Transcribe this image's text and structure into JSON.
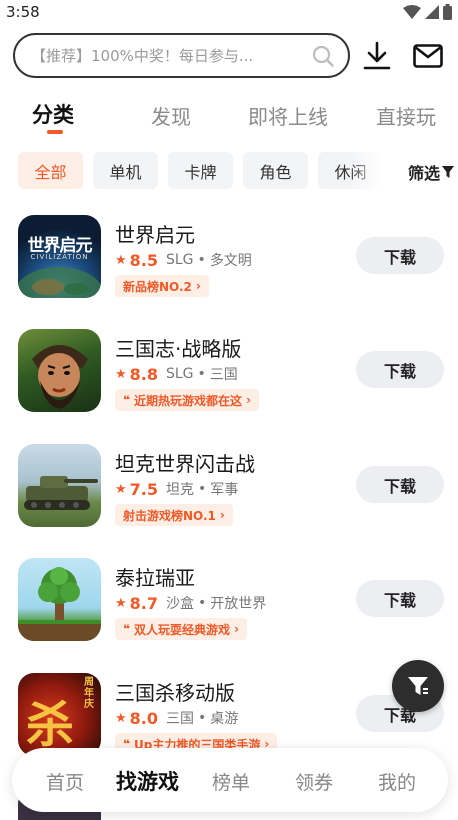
{
  "status_bar": {
    "time": "3:58"
  },
  "search": {
    "placeholder": "【推荐】100%中奖！每日参与..."
  },
  "tabs": [
    {
      "label": "分类",
      "active": true
    },
    {
      "label": "发现",
      "active": false
    },
    {
      "label": "即将上线",
      "active": false
    },
    {
      "label": "直接玩",
      "active": false
    }
  ],
  "chips": [
    {
      "label": "全部",
      "active": true
    },
    {
      "label": "单机",
      "active": false
    },
    {
      "label": "卡牌",
      "active": false
    },
    {
      "label": "角色",
      "active": false
    },
    {
      "label": "休闲",
      "active": false
    }
  ],
  "filter": {
    "label": "筛选"
  },
  "games": [
    {
      "name": "世界启元",
      "score": "8.5",
      "genre": "SLG",
      "theme": "多文明",
      "tag": "新品榜NO.2",
      "download": "下载",
      "icon_text": "世界启元",
      "icon_subtext": "CIVILIZATION"
    },
    {
      "name": "三国志·战略版",
      "score": "8.8",
      "genre": "SLG",
      "theme": "三国",
      "tag": "近期热玩游戏都在这",
      "download": "下载"
    },
    {
      "name": "坦克世界闪击战",
      "score": "7.5",
      "genre": "坦克",
      "theme": "军事",
      "tag": "射击游戏榜NO.1",
      "download": "下载"
    },
    {
      "name": "泰拉瑞亚",
      "score": "8.7",
      "genre": "沙盒",
      "theme": "开放世界",
      "tag": "双人玩耍经典游戏",
      "download": "下载"
    },
    {
      "name": "三国杀移动版",
      "score": "8.0",
      "genre": "三国",
      "theme": "桌游",
      "tag": "Up主力推的三国类手游",
      "download": "下载",
      "icon_text": "杀",
      "icon_badge": "周年庆"
    }
  ],
  "bottom_nav": [
    {
      "label": "首页",
      "active": false
    },
    {
      "label": "找游戏",
      "active": true
    },
    {
      "label": "榜单",
      "active": false
    },
    {
      "label": "领券",
      "active": false
    },
    {
      "label": "我的",
      "active": false
    }
  ],
  "colors": {
    "accent": "#f05a28",
    "button_bg": "#eceef2",
    "tag_bg": "#fdeee6"
  },
  "icons": {
    "search": "search-icon",
    "download": "download-icon",
    "mail": "mail-icon",
    "filter": "filter-icon",
    "star": "star-icon",
    "chevron": "chevron-right-icon"
  }
}
